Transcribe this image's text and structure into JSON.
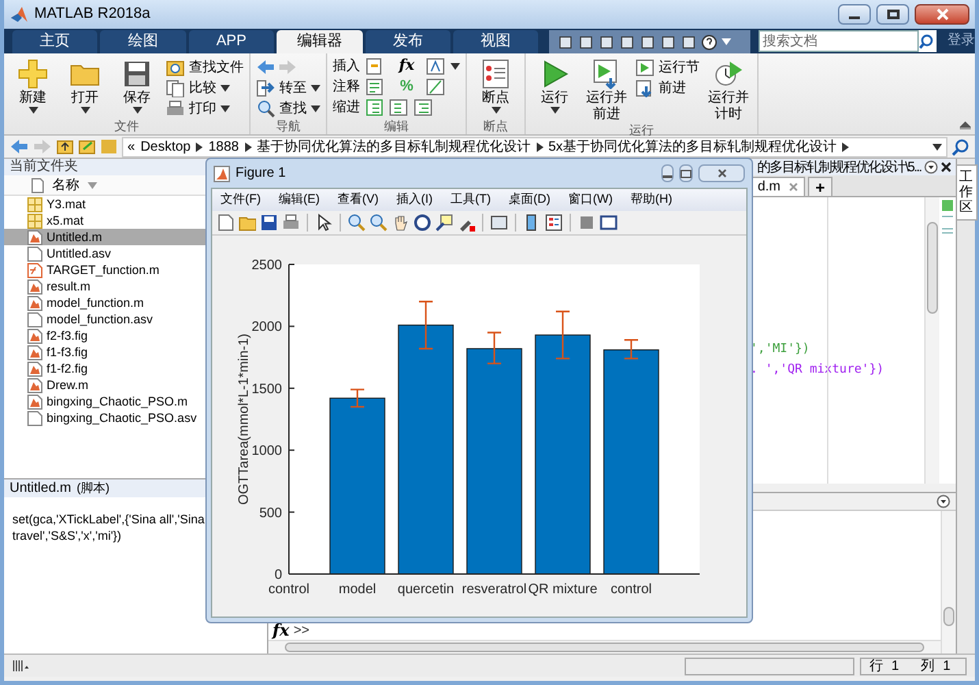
{
  "window": {
    "title": "MATLAB R2018a"
  },
  "tabs": [
    {
      "label": "主页",
      "selected": false
    },
    {
      "label": "绘图",
      "selected": false
    },
    {
      "label": "APP",
      "selected": false
    },
    {
      "label": "编辑器",
      "selected": true
    },
    {
      "label": "发布",
      "selected": false
    },
    {
      "label": "视图",
      "selected": false
    }
  ],
  "search": {
    "placeholder": "搜索文档"
  },
  "sign_in": "登录",
  "ribbon": {
    "groups": [
      {
        "label": "文件",
        "items": [
          {
            "kind": "large",
            "label": "新建",
            "dropdown": true
          },
          {
            "kind": "large",
            "label": "打开",
            "dropdown": true
          },
          {
            "kind": "large",
            "label": "保存",
            "dropdown": true
          },
          {
            "kind": "stack",
            "rows": [
              {
                "label": "查找文件",
                "dropdown": false
              },
              {
                "label": "比较",
                "dropdown": true
              },
              {
                "label": "打印",
                "dropdown": true
              }
            ]
          }
        ]
      },
      {
        "label": "导航",
        "items": [
          {
            "kind": "stack",
            "rows": [
              {
                "kind": "arrows"
              },
              {
                "label": "转至",
                "dropdown": true
              },
              {
                "label": "查找",
                "dropdown": true
              }
            ]
          }
        ]
      },
      {
        "label": "编辑",
        "items": [
          {
            "kind": "edit",
            "rows": [
              {
                "label": "插入",
                "symbol": "fx",
                "dropdown": true
              },
              {
                "label": "注释",
                "symbol": "%",
                "dropdown": false
              },
              {
                "label": "缩进",
                "symbol": "",
                "dropdown": false
              }
            ]
          }
        ]
      },
      {
        "label": "断点",
        "items": [
          {
            "kind": "large",
            "label": "断点",
            "dropdown": true
          }
        ]
      },
      {
        "label": "运行",
        "items": [
          {
            "kind": "large",
            "label": "运行",
            "dropdown": true
          },
          {
            "kind": "large",
            "label": "运行并前进",
            "dropdown": false
          },
          {
            "kind": "stack",
            "rows": [
              {
                "label": "运行节",
                "dropdown": false
              },
              {
                "label": "前进",
                "dropdown": false
              }
            ]
          },
          {
            "kind": "large",
            "label": "运行并计时",
            "dropdown": false
          }
        ]
      }
    ]
  },
  "address_bar": {
    "overflow_mark": "«",
    "segments": [
      "Desktop",
      "1888",
      "基于协同优化算法的多目标轧制规程优化设计",
      "5x基于协同优化算法的多目标轧制规程优化设计"
    ]
  },
  "current_folder": {
    "title": "当前文件夹",
    "column": "名称",
    "files": [
      {
        "name": "Y3.mat",
        "kind": "mat",
        "selected": false
      },
      {
        "name": "x5.mat",
        "kind": "mat",
        "selected": false
      },
      {
        "name": "Untitled.m",
        "kind": "script",
        "selected": true
      },
      {
        "name": "Untitled.asv",
        "kind": "plain",
        "selected": false
      },
      {
        "name": "TARGET_function.m",
        "kind": "function",
        "selected": false
      },
      {
        "name": "result.m",
        "kind": "script",
        "selected": false
      },
      {
        "name": "model_function.m",
        "kind": "script",
        "selected": false
      },
      {
        "name": "model_function.asv",
        "kind": "plain",
        "selected": false
      },
      {
        "name": "f2-f3.fig",
        "kind": "script",
        "selected": false
      },
      {
        "name": "f1-f3.fig",
        "kind": "script",
        "selected": false
      },
      {
        "name": "f1-f2.fig",
        "kind": "script",
        "selected": false
      },
      {
        "name": "Drew.m",
        "kind": "script",
        "selected": false
      },
      {
        "name": "bingxing_Chaotic_PSO.m",
        "kind": "script",
        "selected": false
      },
      {
        "name": "bingxing_Chaotic_PSO.asv",
        "kind": "plain",
        "selected": false
      }
    ]
  },
  "details": {
    "title": "Untitled.m",
    "subtitle": "(脚本)",
    "text": "set(gca,'XTickLabel',{'Sina all','Sina travel','S&S','x','mi'})"
  },
  "editor": {
    "path": "的多目标轧制规程优化设计\\5...",
    "tabs": [
      {
        "label": "d.m",
        "selected": true
      }
    ],
    "add_tab": "+",
    "lines": [
      {
        "text": "','MI'})",
        "kind": "char"
      },
      {
        "text": ". ','QR mixture'})",
        "kind": "string"
      }
    ]
  },
  "command_window": {
    "prompt_icon": "fx",
    "prompt": ">>"
  },
  "workspace_tab": "工作区",
  "status_bar": {
    "row_label": "行",
    "row": "1",
    "col_label": "列",
    "col": "1"
  },
  "figure": {
    "title": "Figure 1",
    "menu": [
      "文件(F)",
      "编辑(E)",
      "查看(V)",
      "插入(I)",
      "工具(T)",
      "桌面(D)",
      "窗口(W)",
      "帮助(H)"
    ],
    "chart_data": {
      "type": "bar",
      "ylabel": "OGTTarea(mmol*L-1*min-1)",
      "categories": [
        "control",
        "model",
        "quercetin",
        "resveratrol",
        "QR mixture",
        "control"
      ],
      "series": [
        {
          "color": "#0072bd",
          "values": [
            null,
            1420,
            2010,
            1820,
            1930,
            1810
          ]
        }
      ],
      "ylim": [
        0,
        2500
      ],
      "yticks": [
        0,
        500,
        1000,
        1500,
        2000,
        2500
      ]
    }
  }
}
